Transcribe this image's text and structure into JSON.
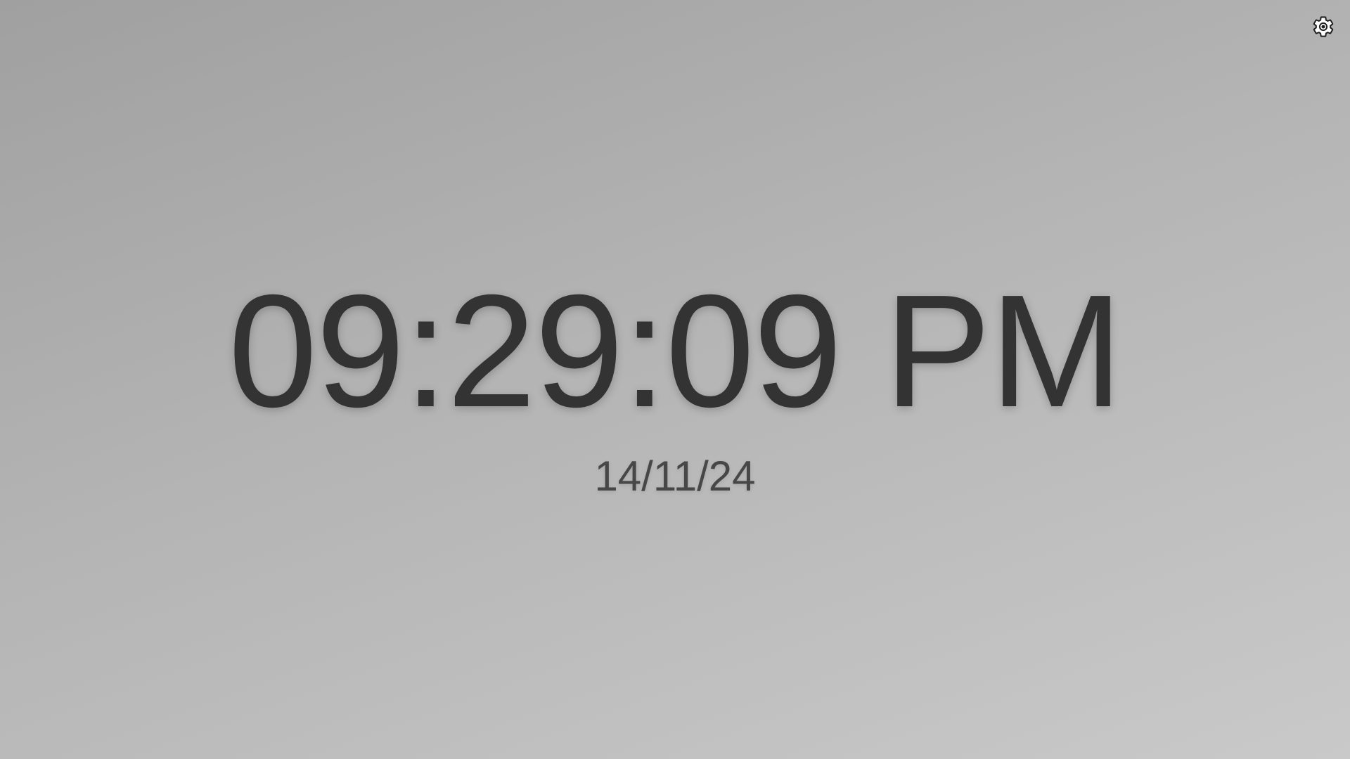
{
  "clock": {
    "time": "09:29:09 PM",
    "date": "14/11/24"
  },
  "settings": {
    "icon": "gear-icon"
  },
  "colors": {
    "background_top_left": "#a0a0a0",
    "background_bottom_right": "#c9c9c9",
    "time_text": "#333333",
    "date_text": "#474747",
    "icon": "#1f1f1f"
  }
}
